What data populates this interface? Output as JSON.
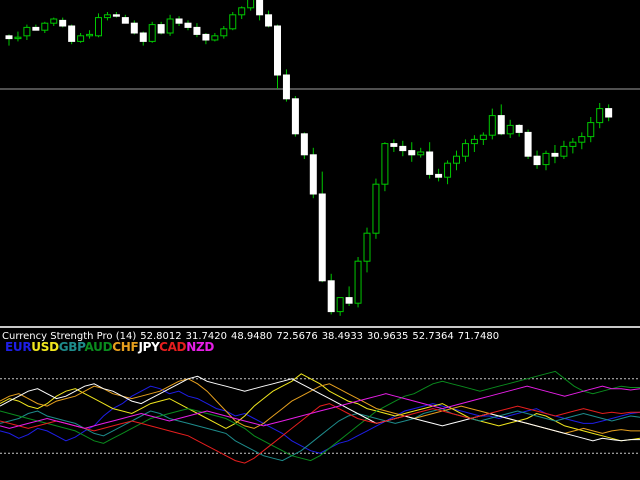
{
  "indicator": {
    "title": "Currency Strength Pro (14)",
    "values": [
      "52.8012",
      "31.7420",
      "48.9480",
      "72.5676",
      "38.4933",
      "30.9635",
      "52.7364",
      "71.7480"
    ]
  },
  "legend": [
    {
      "label": "EUR",
      "color": "#1e1ee6"
    },
    {
      "label": "USD",
      "color": "#f0e61e"
    },
    {
      "label": "GBP",
      "color": "#1e8c8c"
    },
    {
      "label": "AUD",
      "color": "#0a8c1e"
    },
    {
      "label": "CHF",
      "color": "#e6a01e"
    },
    {
      "label": "JPY",
      "color": "#ffffff"
    },
    {
      "label": "CAD",
      "color": "#e61e1e"
    },
    {
      "label": "NZD",
      "color": "#e61ee6"
    }
  ],
  "colors": {
    "background": "#000000",
    "bull_candle": "#ffffff",
    "bear_candle": "#ffffff",
    "wick": "#00c800",
    "price_line": "#a0a0a0",
    "divider": "#c8c8c8",
    "level_line": "#c8c8c8"
  },
  "chart_data": [
    {
      "type": "candlestick",
      "candles": [
        [
          38,
          39,
          31,
          36
        ],
        [
          36,
          41,
          34,
          37
        ],
        [
          38,
          46,
          35,
          44
        ],
        [
          44,
          46,
          42,
          42
        ],
        [
          42,
          48,
          40,
          47
        ],
        [
          47,
          51,
          45,
          50
        ],
        [
          49,
          51,
          44,
          45
        ],
        [
          45,
          46,
          32,
          34
        ],
        [
          34,
          40,
          33,
          38
        ],
        [
          38,
          42,
          36,
          39
        ],
        [
          38,
          54,
          37,
          51
        ],
        [
          51,
          55,
          49,
          53
        ],
        [
          53,
          55,
          51,
          52
        ],
        [
          51,
          53,
          47,
          47
        ],
        [
          47,
          49,
          39,
          40
        ],
        [
          40,
          41,
          31,
          34
        ],
        [
          34,
          48,
          33,
          46
        ],
        [
          46,
          48,
          39,
          40
        ],
        [
          40,
          53,
          38,
          50
        ],
        [
          50,
          52,
          45,
          47
        ],
        [
          47,
          49,
          42,
          44
        ],
        [
          44,
          47,
          37,
          39
        ],
        [
          39,
          40,
          32,
          35
        ],
        [
          35,
          40,
          34,
          38
        ],
        [
          38,
          45,
          36,
          43
        ],
        [
          43,
          55,
          42,
          53
        ],
        [
          53,
          59,
          50,
          58
        ],
        [
          58,
          75,
          56,
          70
        ],
        [
          70,
          71,
          49,
          53
        ],
        [
          53,
          56,
          44,
          45
        ],
        [
          45,
          46,
          0,
          10
        ],
        [
          10,
          14,
          -9,
          -7
        ],
        [
          -7,
          -5,
          -34,
          -32
        ],
        [
          -32,
          -31,
          -50,
          -47
        ],
        [
          -47,
          -42,
          -78,
          -75
        ],
        [
          -75,
          -59,
          -138,
          -137
        ],
        [
          -137,
          -132,
          -161,
          -159
        ],
        [
          -159,
          -155,
          -162,
          -149
        ],
        [
          -149,
          -141,
          -155,
          -153
        ],
        [
          -153,
          -120,
          -156,
          -123
        ],
        [
          -123,
          -99,
          -131,
          -103
        ],
        [
          -103,
          -64,
          -107,
          -68
        ],
        [
          -68,
          -38,
          -73,
          -39
        ],
        [
          -39,
          -36,
          -45,
          -41
        ],
        [
          -41,
          -37,
          -48,
          -44
        ],
        [
          -44,
          -38,
          -52,
          -47
        ],
        [
          -47,
          -42,
          -49,
          -45
        ],
        [
          -45,
          -38,
          -64,
          -61
        ],
        [
          -61,
          -57,
          -66,
          -63
        ],
        [
          -63,
          -51,
          -68,
          -53
        ],
        [
          -53,
          -44,
          -58,
          -48
        ],
        [
          -48,
          -36,
          -52,
          -39
        ],
        [
          -39,
          -33,
          -45,
          -36
        ],
        [
          -36,
          -31,
          -40,
          -33
        ],
        [
          -33,
          -14,
          -36,
          -19
        ],
        [
          -19,
          -11,
          -33,
          -32
        ],
        [
          -32,
          -22,
          -35,
          -26
        ],
        [
          -26,
          -25,
          -34,
          -31
        ],
        [
          -31,
          -29,
          -50,
          -48
        ],
        [
          -48,
          -44,
          -57,
          -54
        ],
        [
          -54,
          -44,
          -58,
          -46
        ],
        [
          -46,
          -40,
          -53,
          -48
        ],
        [
          -48,
          -37,
          -50,
          -41
        ],
        [
          -41,
          -35,
          -46,
          -38
        ],
        [
          -38,
          -31,
          -43,
          -34
        ],
        [
          -34,
          -20,
          -38,
          -24
        ],
        [
          -24,
          -10,
          -28,
          -14
        ],
        [
          -14,
          -11,
          -23,
          -20
        ]
      ],
      "price_level": 0
    },
    {
      "type": "line",
      "title": "Currency Strength Pro (14)",
      "levels": [
        80,
        20
      ],
      "ylim": [
        0,
        100
      ],
      "series": [
        {
          "name": "EUR",
          "values": [
            38,
            36,
            32,
            35,
            40,
            38,
            34,
            30,
            33,
            38,
            42,
            50,
            56,
            60,
            66,
            70,
            74,
            72,
            68,
            70,
            66,
            64,
            60,
            56,
            54,
            50,
            52,
            48,
            44,
            40,
            36,
            30,
            26,
            22,
            20,
            24,
            28,
            30,
            34,
            38,
            42,
            46,
            50,
            54,
            56,
            58,
            60,
            58,
            56,
            54,
            52,
            50,
            50,
            48,
            50,
            52,
            54,
            56,
            52,
            50,
            48,
            46,
            44,
            44,
            46,
            48,
            50,
            52,
            53
          ]
        },
        {
          "name": "USD",
          "values": [
            60,
            64,
            62,
            58,
            56,
            60,
            66,
            70,
            72,
            68,
            64,
            60,
            56,
            54,
            52,
            56,
            60,
            62,
            64,
            60,
            56,
            52,
            48,
            44,
            40,
            44,
            50,
            58,
            64,
            70,
            74,
            78,
            84,
            80,
            76,
            70,
            66,
            62,
            60,
            56,
            54,
            52,
            50,
            52,
            54,
            56,
            58,
            60,
            56,
            52,
            48,
            46,
            44,
            42,
            44,
            46,
            48,
            52,
            50,
            46,
            42,
            40,
            38,
            36,
            34,
            32,
            30,
            31,
            32
          ]
        },
        {
          "name": "GBP",
          "values": [
            44,
            46,
            48,
            52,
            54,
            50,
            48,
            46,
            44,
            40,
            36,
            34,
            38,
            42,
            46,
            50,
            54,
            52,
            48,
            46,
            44,
            42,
            40,
            38,
            36,
            30,
            26,
            22,
            18,
            16,
            14,
            18,
            22,
            28,
            34,
            40,
            46,
            50,
            52,
            50,
            48,
            46,
            44,
            46,
            48,
            52,
            54,
            56,
            52,
            50,
            48,
            46,
            48,
            50,
            52,
            54,
            52,
            50,
            48,
            46,
            48,
            50,
            52,
            50,
            48,
            46,
            48,
            50,
            49
          ]
        },
        {
          "name": "AUD",
          "values": [
            54,
            52,
            50,
            48,
            46,
            44,
            42,
            40,
            38,
            34,
            30,
            28,
            32,
            36,
            40,
            44,
            48,
            50,
            52,
            54,
            56,
            54,
            52,
            50,
            48,
            44,
            40,
            34,
            30,
            26,
            22,
            18,
            16,
            14,
            18,
            24,
            30,
            36,
            42,
            48,
            54,
            58,
            62,
            66,
            68,
            72,
            76,
            78,
            76,
            74,
            72,
            70,
            72,
            74,
            76,
            78,
            80,
            82,
            84,
            86,
            80,
            74,
            70,
            68,
            70,
            72,
            74,
            73,
            73
          ]
        },
        {
          "name": "CHF",
          "values": [
            62,
            66,
            68,
            64,
            60,
            58,
            62,
            64,
            66,
            70,
            74,
            72,
            68,
            66,
            64,
            66,
            68,
            70,
            74,
            78,
            80,
            76,
            70,
            62,
            54,
            46,
            42,
            40,
            44,
            50,
            56,
            62,
            66,
            70,
            74,
            76,
            72,
            68,
            64,
            60,
            56,
            54,
            52,
            50,
            48,
            50,
            52,
            54,
            56,
            58,
            56,
            54,
            52,
            50,
            48,
            46,
            44,
            42,
            40,
            38,
            36,
            38,
            40,
            38,
            36,
            38,
            39,
            38,
            38
          ]
        },
        {
          "name": "JPY",
          "values": [
            58,
            62,
            66,
            70,
            72,
            68,
            64,
            66,
            70,
            74,
            76,
            72,
            70,
            66,
            62,
            60,
            64,
            68,
            72,
            76,
            80,
            82,
            78,
            76,
            74,
            72,
            70,
            72,
            74,
            76,
            78,
            80,
            76,
            72,
            68,
            64,
            60,
            56,
            52,
            48,
            44,
            46,
            48,
            50,
            48,
            46,
            44,
            42,
            44,
            46,
            48,
            50,
            52,
            50,
            48,
            46,
            44,
            42,
            40,
            38,
            36,
            34,
            32,
            30,
            32,
            31,
            30,
            31,
            31
          ]
        },
        {
          "name": "CAD",
          "values": [
            46,
            44,
            42,
            40,
            42,
            44,
            46,
            44,
            42,
            40,
            38,
            40,
            42,
            44,
            46,
            44,
            42,
            40,
            38,
            36,
            34,
            30,
            26,
            22,
            18,
            14,
            12,
            16,
            22,
            28,
            34,
            40,
            46,
            52,
            58,
            60,
            56,
            52,
            48,
            46,
            44,
            46,
            48,
            50,
            52,
            54,
            56,
            54,
            52,
            50,
            48,
            50,
            52,
            54,
            56,
            58,
            56,
            54,
            52,
            50,
            52,
            54,
            56,
            54,
            52,
            53,
            52,
            53,
            53
          ]
        },
        {
          "name": "NZD",
          "values": [
            42,
            40,
            42,
            44,
            46,
            48,
            46,
            44,
            42,
            40,
            42,
            44,
            46,
            48,
            50,
            52,
            50,
            48,
            46,
            48,
            50,
            52,
            54,
            52,
            50,
            48,
            46,
            44,
            42,
            44,
            46,
            48,
            50,
            52,
            54,
            56,
            58,
            60,
            62,
            64,
            66,
            68,
            66,
            64,
            62,
            60,
            58,
            56,
            58,
            60,
            62,
            64,
            66,
            68,
            70,
            72,
            74,
            72,
            70,
            68,
            66,
            68,
            70,
            72,
            74,
            72,
            72,
            71,
            72
          ]
        }
      ]
    }
  ]
}
